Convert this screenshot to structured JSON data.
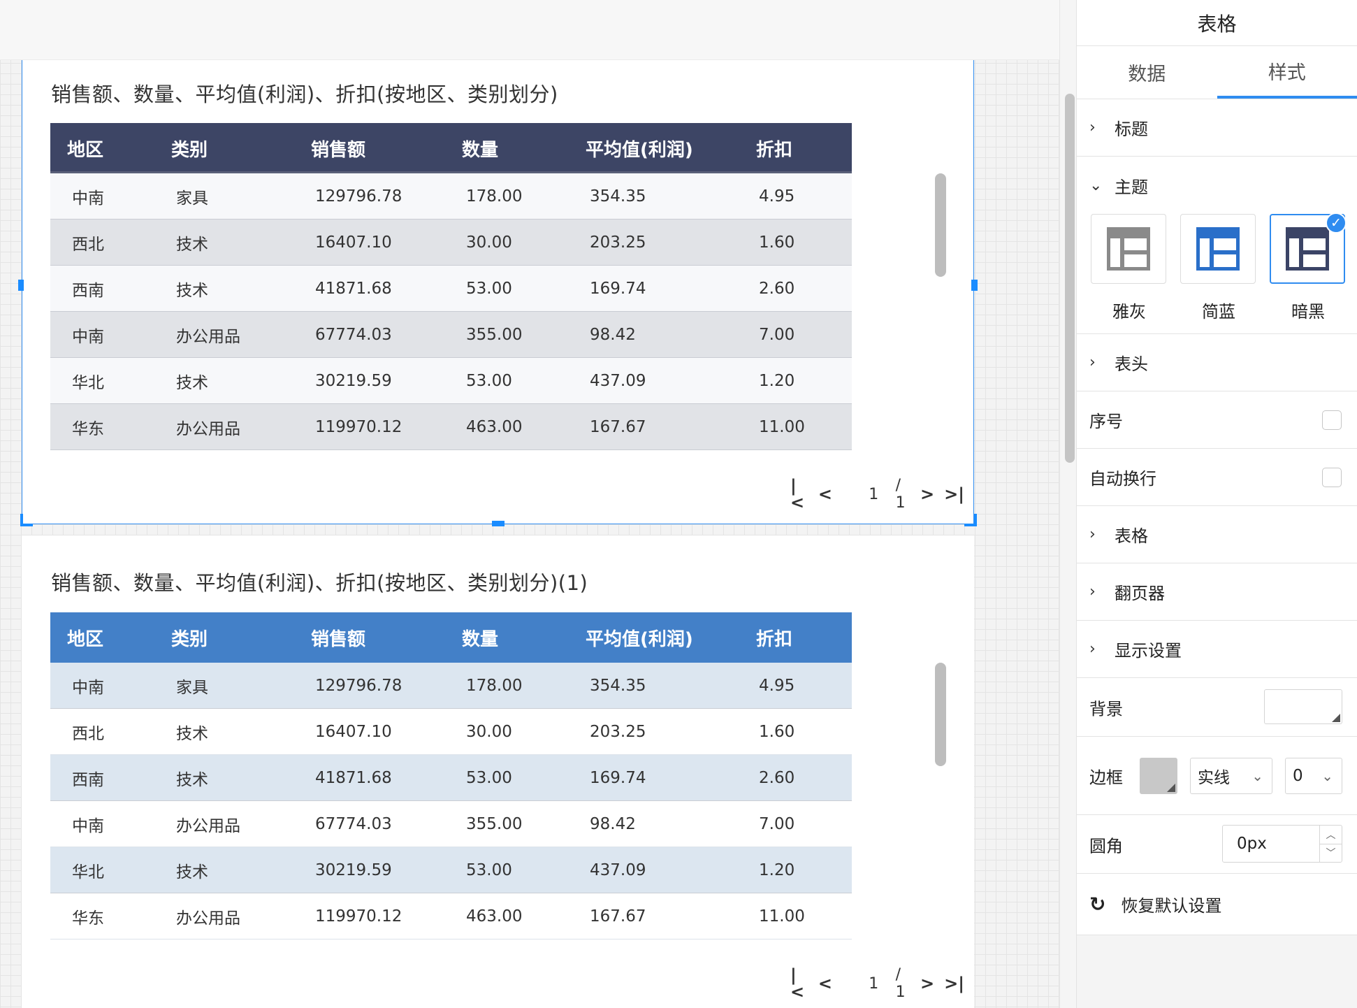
{
  "canvas": {
    "widgets": [
      {
        "title": "销售额、数量、平均值(利润)、折扣(按地区、类别划分)",
        "theme_colors": {
          "header_bg": "#3d4565",
          "row_odd": "#f7f8fa",
          "row_even": "#e1e3e7"
        }
      },
      {
        "title": "销售额、数量、平均值(利润)、折扣(按地区、类别划分)(1)",
        "theme_colors": {
          "header_bg": "#4380c8",
          "row_odd": "#dce6f0",
          "row_even": "#ffffff"
        }
      }
    ],
    "table": {
      "columns": [
        "地区",
        "类别",
        "销售额",
        "数量",
        "平均值(利润)",
        "折扣"
      ],
      "rows": [
        [
          "中南",
          "家具",
          "129796.78",
          "178.00",
          "354.35",
          "4.95"
        ],
        [
          "西北",
          "技术",
          "16407.10",
          "30.00",
          "203.25",
          "1.60"
        ],
        [
          "西南",
          "技术",
          "41871.68",
          "53.00",
          "169.74",
          "2.60"
        ],
        [
          "中南",
          "办公用品",
          "67774.03",
          "355.00",
          "98.42",
          "7.00"
        ],
        [
          "华北",
          "技术",
          "30219.59",
          "53.00",
          "437.09",
          "1.20"
        ],
        [
          "华东",
          "办公用品",
          "119970.12",
          "463.00",
          "167.67",
          "11.00"
        ]
      ]
    },
    "pager": {
      "first": "|<",
      "prev": "<",
      "current": "1",
      "total": "/ 1",
      "next": ">",
      "last": ">|"
    }
  },
  "panel": {
    "title": "表格",
    "tabs": [
      {
        "label": "数据"
      },
      {
        "label": "样式",
        "active": true
      }
    ],
    "sections": {
      "title": "标题",
      "theme": "主题",
      "header": "表头",
      "row_number": "序号",
      "auto_wrap": "自动换行",
      "table": "表格",
      "pager": "翻页器",
      "display": "显示设置"
    },
    "themes": [
      {
        "label": "雅灰",
        "color": "#8a8a8a",
        "selected": false
      },
      {
        "label": "简蓝",
        "color": "#2a6fc9",
        "selected": true
      },
      {
        "label": "暗黑",
        "color": "#3b4466",
        "selected": true
      }
    ],
    "background": {
      "label": "背景",
      "color": "#ffffff"
    },
    "border": {
      "label": "边框",
      "color": "#c8c8c8",
      "style": "实线",
      "width": "0"
    },
    "radius": {
      "label": "圆角",
      "value": "0px"
    },
    "reset_label": "恢复默认设置",
    "accent": "#2f8cf0"
  }
}
